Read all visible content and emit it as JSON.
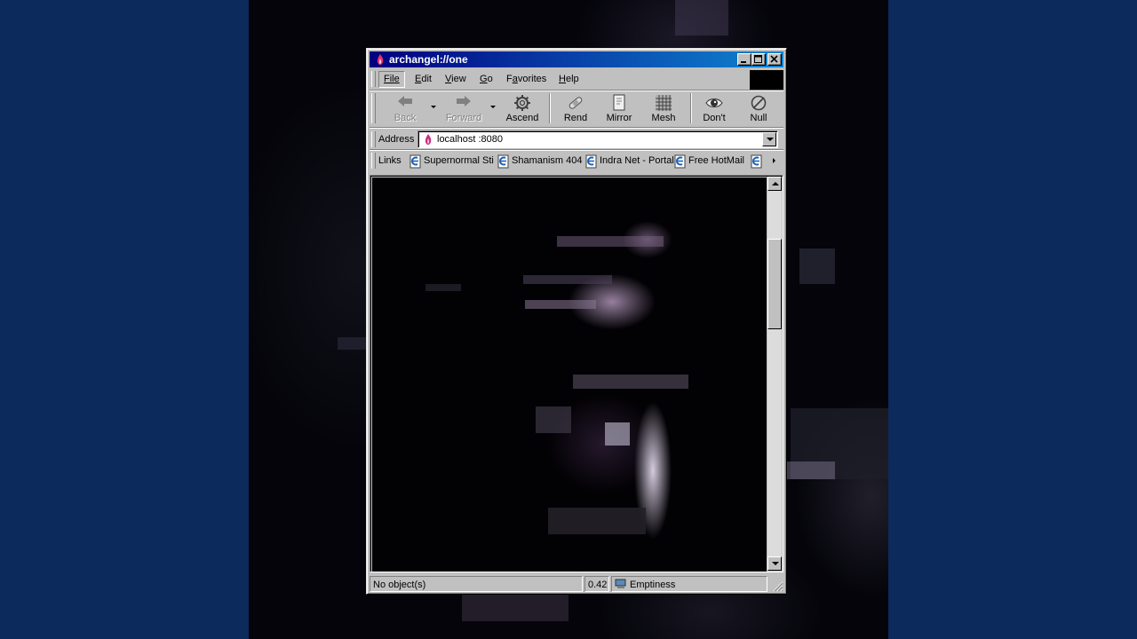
{
  "window": {
    "title": "archangel://one",
    "caption_buttons": [
      "minimize",
      "maximize",
      "close"
    ]
  },
  "menu": {
    "items": [
      {
        "label": "File",
        "accel": "F"
      },
      {
        "label": "Edit",
        "accel": "E"
      },
      {
        "label": "View",
        "accel": "V"
      },
      {
        "label": "Go",
        "accel": "G"
      },
      {
        "label": "Favorites",
        "accel": "a"
      },
      {
        "label": "Help",
        "accel": "H"
      }
    ]
  },
  "toolbar": {
    "buttons": [
      {
        "label": "Back",
        "icon": "arrow-left-icon",
        "disabled": true
      },
      {
        "label": "Forward",
        "icon": "arrow-right-icon",
        "disabled": true
      },
      {
        "label": "Ascend",
        "icon": "gear-icon",
        "disabled": false
      },
      {
        "label": "Rend",
        "icon": "bandage-icon",
        "disabled": false
      },
      {
        "label": "Mirror",
        "icon": "document-icon",
        "disabled": false
      },
      {
        "label": "Mesh",
        "icon": "grid-icon",
        "disabled": false
      },
      {
        "label": "Don't",
        "icon": "eye-icon",
        "disabled": false
      },
      {
        "label": "Null",
        "icon": "null-icon",
        "disabled": false
      }
    ]
  },
  "address": {
    "label": "Address",
    "value": "localhost :8080"
  },
  "links": {
    "label": "Links",
    "items": [
      "Supernormal Sti",
      "Shamanism 404",
      "Indra Net - Portal",
      "Free HotMail",
      ""
    ]
  },
  "status": {
    "text": "No object(s)",
    "value": "0.42",
    "zone": "Emptiness"
  },
  "colors": {
    "desktop": "#0d2a5c",
    "title_start": "#000080",
    "title_end": "#1084d0",
    "chrome": "#c0c0c0",
    "flame": "#e8306a"
  }
}
